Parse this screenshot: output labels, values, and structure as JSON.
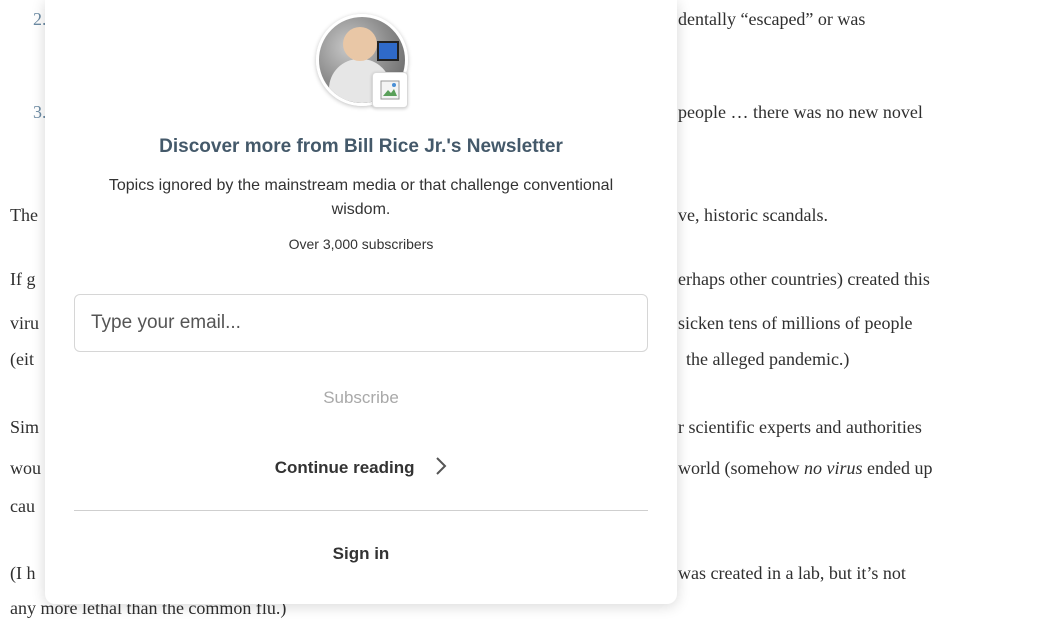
{
  "article": {
    "items": [
      {
        "num": "2.",
        "text": "dentally “escaped” or was"
      },
      {
        "num": "3.",
        "text": "people … there was no new novel"
      }
    ],
    "p1": {
      "start": "The",
      "end": "ve, historic scandals."
    },
    "p2": [
      {
        "start": "If g",
        "end": "erhaps other countries) created this"
      },
      {
        "start": "viru",
        "end": "sicken tens of millions of people"
      },
      {
        "start": "(eit",
        "end": "the alleged pandemic.)"
      }
    ],
    "p3": [
      {
        "start": "Sim",
        "end": "r scientific experts and authorities"
      },
      {
        "start": "wou",
        "end_a": "world (somehow ",
        "end_em": "no virus",
        "end_b": " ended up"
      },
      {
        "start": "cau"
      }
    ],
    "p4": [
      {
        "start": "(I h",
        "end": "was created in a lab, but it’s not"
      },
      {
        "full": "any more lethal than the common flu.)"
      }
    ]
  },
  "modal": {
    "avatar": "author-photo",
    "badge_icon": "broken-image-icon",
    "title": "Discover more from Bill Rice Jr.'s Newsletter",
    "description": "Topics ignored by the mainstream media or that challenge conventional wisdom.",
    "subscribers": "Over 3,000 subscribers",
    "email_placeholder": "Type your email...",
    "subscribe_label": "Subscribe",
    "continue_label": "Continue reading",
    "continue_icon": "chevron-right-icon",
    "signin_label": "Sign in"
  }
}
